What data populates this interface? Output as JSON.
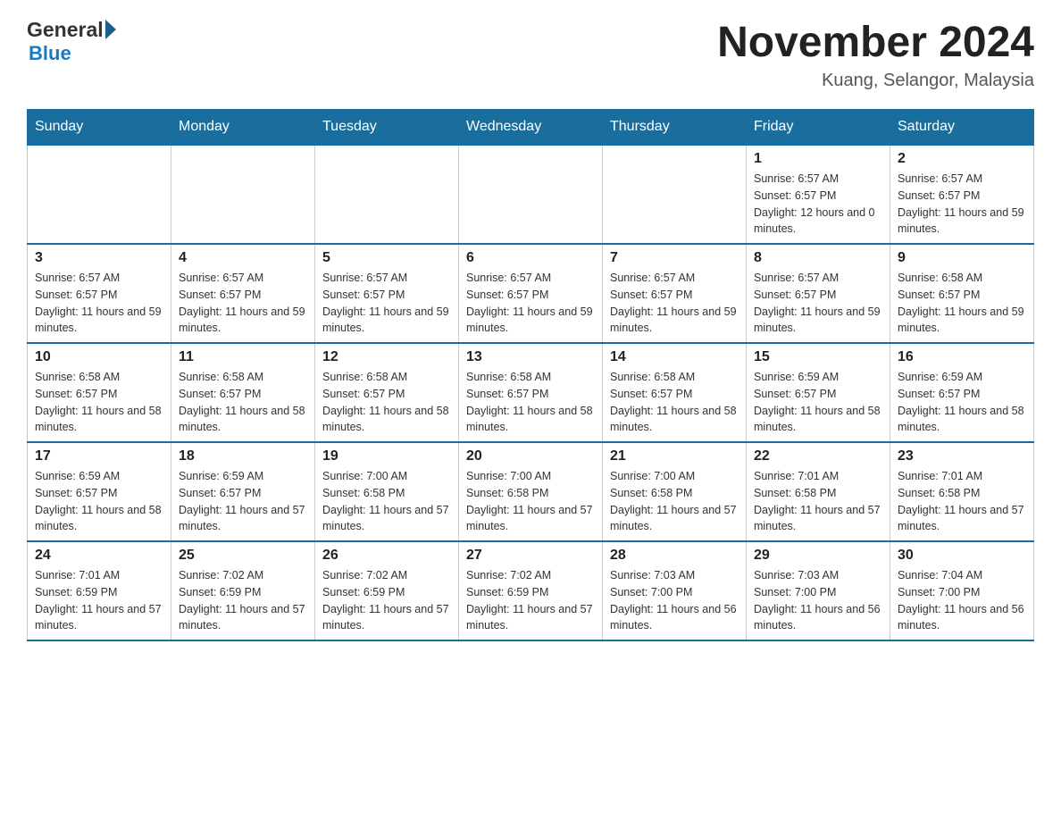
{
  "header": {
    "logo_general": "General",
    "logo_blue": "Blue",
    "title": "November 2024",
    "subtitle": "Kuang, Selangor, Malaysia"
  },
  "calendar": {
    "days_of_week": [
      "Sunday",
      "Monday",
      "Tuesday",
      "Wednesday",
      "Thursday",
      "Friday",
      "Saturday"
    ],
    "weeks": [
      [
        {
          "day": "",
          "info": ""
        },
        {
          "day": "",
          "info": ""
        },
        {
          "day": "",
          "info": ""
        },
        {
          "day": "",
          "info": ""
        },
        {
          "day": "",
          "info": ""
        },
        {
          "day": "1",
          "info": "Sunrise: 6:57 AM\nSunset: 6:57 PM\nDaylight: 12 hours and 0 minutes."
        },
        {
          "day": "2",
          "info": "Sunrise: 6:57 AM\nSunset: 6:57 PM\nDaylight: 11 hours and 59 minutes."
        }
      ],
      [
        {
          "day": "3",
          "info": "Sunrise: 6:57 AM\nSunset: 6:57 PM\nDaylight: 11 hours and 59 minutes."
        },
        {
          "day": "4",
          "info": "Sunrise: 6:57 AM\nSunset: 6:57 PM\nDaylight: 11 hours and 59 minutes."
        },
        {
          "day": "5",
          "info": "Sunrise: 6:57 AM\nSunset: 6:57 PM\nDaylight: 11 hours and 59 minutes."
        },
        {
          "day": "6",
          "info": "Sunrise: 6:57 AM\nSunset: 6:57 PM\nDaylight: 11 hours and 59 minutes."
        },
        {
          "day": "7",
          "info": "Sunrise: 6:57 AM\nSunset: 6:57 PM\nDaylight: 11 hours and 59 minutes."
        },
        {
          "day": "8",
          "info": "Sunrise: 6:57 AM\nSunset: 6:57 PM\nDaylight: 11 hours and 59 minutes."
        },
        {
          "day": "9",
          "info": "Sunrise: 6:58 AM\nSunset: 6:57 PM\nDaylight: 11 hours and 59 minutes."
        }
      ],
      [
        {
          "day": "10",
          "info": "Sunrise: 6:58 AM\nSunset: 6:57 PM\nDaylight: 11 hours and 58 minutes."
        },
        {
          "day": "11",
          "info": "Sunrise: 6:58 AM\nSunset: 6:57 PM\nDaylight: 11 hours and 58 minutes."
        },
        {
          "day": "12",
          "info": "Sunrise: 6:58 AM\nSunset: 6:57 PM\nDaylight: 11 hours and 58 minutes."
        },
        {
          "day": "13",
          "info": "Sunrise: 6:58 AM\nSunset: 6:57 PM\nDaylight: 11 hours and 58 minutes."
        },
        {
          "day": "14",
          "info": "Sunrise: 6:58 AM\nSunset: 6:57 PM\nDaylight: 11 hours and 58 minutes."
        },
        {
          "day": "15",
          "info": "Sunrise: 6:59 AM\nSunset: 6:57 PM\nDaylight: 11 hours and 58 minutes."
        },
        {
          "day": "16",
          "info": "Sunrise: 6:59 AM\nSunset: 6:57 PM\nDaylight: 11 hours and 58 minutes."
        }
      ],
      [
        {
          "day": "17",
          "info": "Sunrise: 6:59 AM\nSunset: 6:57 PM\nDaylight: 11 hours and 58 minutes."
        },
        {
          "day": "18",
          "info": "Sunrise: 6:59 AM\nSunset: 6:57 PM\nDaylight: 11 hours and 57 minutes."
        },
        {
          "day": "19",
          "info": "Sunrise: 7:00 AM\nSunset: 6:58 PM\nDaylight: 11 hours and 57 minutes."
        },
        {
          "day": "20",
          "info": "Sunrise: 7:00 AM\nSunset: 6:58 PM\nDaylight: 11 hours and 57 minutes."
        },
        {
          "day": "21",
          "info": "Sunrise: 7:00 AM\nSunset: 6:58 PM\nDaylight: 11 hours and 57 minutes."
        },
        {
          "day": "22",
          "info": "Sunrise: 7:01 AM\nSunset: 6:58 PM\nDaylight: 11 hours and 57 minutes."
        },
        {
          "day": "23",
          "info": "Sunrise: 7:01 AM\nSunset: 6:58 PM\nDaylight: 11 hours and 57 minutes."
        }
      ],
      [
        {
          "day": "24",
          "info": "Sunrise: 7:01 AM\nSunset: 6:59 PM\nDaylight: 11 hours and 57 minutes."
        },
        {
          "day": "25",
          "info": "Sunrise: 7:02 AM\nSunset: 6:59 PM\nDaylight: 11 hours and 57 minutes."
        },
        {
          "day": "26",
          "info": "Sunrise: 7:02 AM\nSunset: 6:59 PM\nDaylight: 11 hours and 57 minutes."
        },
        {
          "day": "27",
          "info": "Sunrise: 7:02 AM\nSunset: 6:59 PM\nDaylight: 11 hours and 57 minutes."
        },
        {
          "day": "28",
          "info": "Sunrise: 7:03 AM\nSunset: 7:00 PM\nDaylight: 11 hours and 56 minutes."
        },
        {
          "day": "29",
          "info": "Sunrise: 7:03 AM\nSunset: 7:00 PM\nDaylight: 11 hours and 56 minutes."
        },
        {
          "day": "30",
          "info": "Sunrise: 7:04 AM\nSunset: 7:00 PM\nDaylight: 11 hours and 56 minutes."
        }
      ]
    ]
  }
}
